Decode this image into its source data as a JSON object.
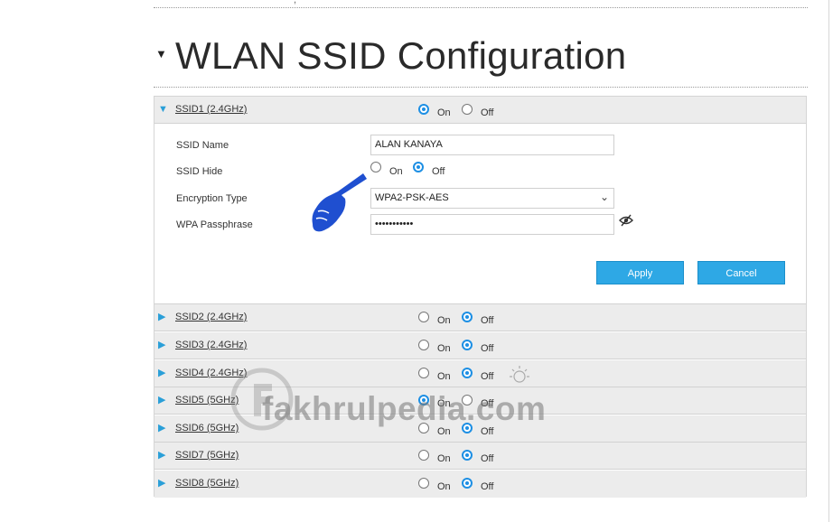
{
  "title": "WLAN SSID Configuration",
  "radio_on": "On",
  "radio_off": "Off",
  "ssid1": {
    "label": "SSID1 (2.4GHz)",
    "state": "On",
    "fields": {
      "ssid_name_label": "SSID Name",
      "ssid_name_value": "ALAN KANAYA",
      "ssid_hide_label": "SSID Hide",
      "ssid_hide_state": "Off",
      "encryption_label": "Encryption Type",
      "encryption_value": "WPA2-PSK-AES",
      "passphrase_label": "WPA Passphrase",
      "passphrase_value": "•••••••••••"
    },
    "apply_label": "Apply",
    "cancel_label": "Cancel"
  },
  "ssids": [
    {
      "label": "SSID2 (2.4GHz)",
      "state": "Off"
    },
    {
      "label": "SSID3 (2.4GHz)",
      "state": "Off"
    },
    {
      "label": "SSID4 (2.4GHz)",
      "state": "Off"
    },
    {
      "label": "SSID5 (5GHz)",
      "state": "On"
    },
    {
      "label": "SSID6 (5GHz)",
      "state": "Off"
    },
    {
      "label": "SSID7 (5GHz)",
      "state": "Off"
    },
    {
      "label": "SSID8 (5GHz)",
      "state": "Off"
    }
  ],
  "watermark": "fakhrulpedia.com",
  "icons": {
    "expanded": "triangle-down-icon",
    "collapsed": "triangle-right-icon",
    "eye": "eye-hidden-icon",
    "pointer": "pointing-hand-icon"
  },
  "colors": {
    "accent": "#2ea8e5",
    "radio": "#1d8fe4",
    "row_bg": "#ececec"
  }
}
